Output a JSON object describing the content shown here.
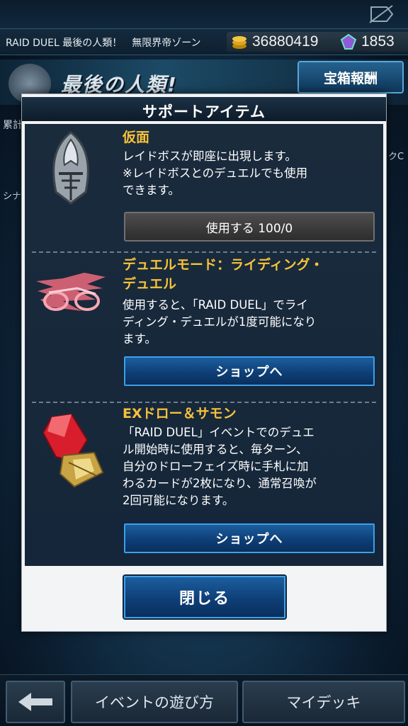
{
  "header": {
    "event_title": "RAID DUEL 最後の人類！　無限界帝ゾーン",
    "coins": "36880419",
    "gems": "1853"
  },
  "banner": {
    "title": "最後の人類!",
    "reward_button": "宝箱報酬",
    "side_left_1": "累計",
    "side_left_2": "シナ",
    "side_right": "クC"
  },
  "modal": {
    "title": "サポートアイテム",
    "items": [
      {
        "name": "仮面",
        "description": "レイドボスが即座に出現します。\n※レイドボスとのデュエルでも使用\nできます。",
        "button": "使用する 100/0"
      },
      {
        "name": "デュエルモード：ライディング・\nデュエル",
        "description": "使用すると、「RAID DUEL」でライ\nディング・デュエルが1度可能になり\nます。",
        "button": "ショップへ"
      },
      {
        "name": "EXドロー＆サモン",
        "description": "「RAID DUEL」イベントでのデュエ\nル開始時に使用すると、毎ターン、\n自分のドローフェイズ時に手札に加\nわるカードが2枚になり、通常召喚が\n2回可能になります。",
        "button": "ショップへ"
      }
    ],
    "close_button": "閉じる"
  },
  "bottom_nav": {
    "back_icon": "arrow-left-icon",
    "how_to_play": "イベントの遊び方",
    "my_deck": "マイデッキ"
  },
  "colors": {
    "item_name": "#f6c23a",
    "button_blue": "#0e3f77",
    "button_border": "#3fa0e6"
  }
}
